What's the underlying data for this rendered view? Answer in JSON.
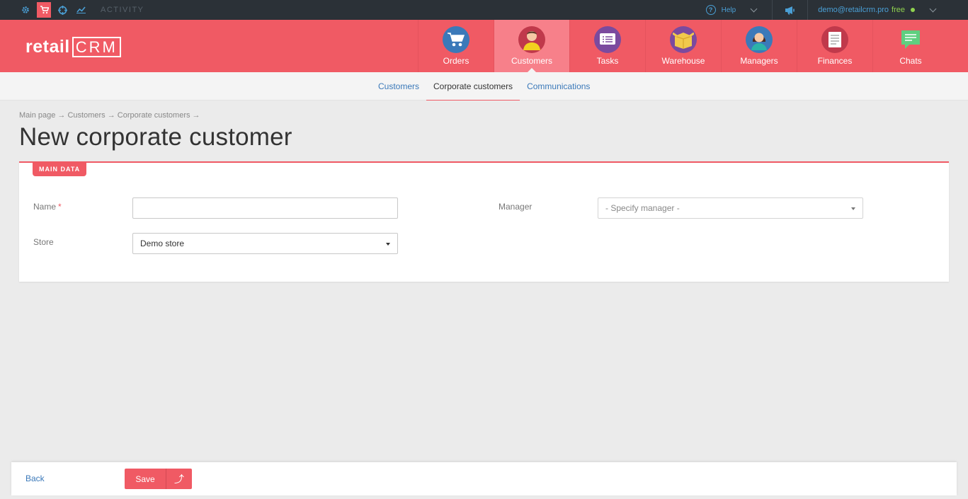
{
  "topbar": {
    "icons": [
      "gear-icon",
      "cart-icon",
      "target-icon",
      "chart-icon"
    ],
    "activity_label": "ACTIVITY",
    "help_label": "Help",
    "user_email": "demo@retailcrm.pro",
    "plan_label": "free"
  },
  "header": {
    "logo_text": "retail",
    "logo_crm": "CRM",
    "nav": [
      {
        "label": "Orders",
        "icon": "cart-icon",
        "color": "#3b79b9"
      },
      {
        "label": "Customers",
        "icon": "person-icon",
        "color": "#c0394b"
      },
      {
        "label": "Tasks",
        "icon": "list-icon",
        "color": "#7b4a9e"
      },
      {
        "label": "Warehouse",
        "icon": "box-icon",
        "color": "#7b4a9e"
      },
      {
        "label": "Managers",
        "icon": "woman-icon",
        "color": "#3b79b9"
      },
      {
        "label": "Finances",
        "icon": "document-icon",
        "color": "#c0394b"
      },
      {
        "label": "Chats",
        "icon": "chat-icon",
        "color": "#f05a64"
      }
    ]
  },
  "subnav": {
    "tabs": [
      "Customers",
      "Corporate customers",
      "Communications"
    ]
  },
  "breadcrumb": "Main page → Customers → Corporate customers →",
  "page_title": "New corporate customer",
  "panel": {
    "tag": "MAIN DATA",
    "name_label": "Name",
    "required_mark": "*",
    "name_value": "",
    "store_label": "Store",
    "store_value": "Demo store",
    "manager_label": "Manager",
    "manager_placeholder": "- Specify manager -"
  },
  "footer": {
    "back_label": "Back",
    "save_label": "Save",
    "save_more_icon": "⤴"
  },
  "colors": {
    "brand": "#f05a64",
    "topbar": "#2b3137",
    "link": "#3b79b9"
  }
}
